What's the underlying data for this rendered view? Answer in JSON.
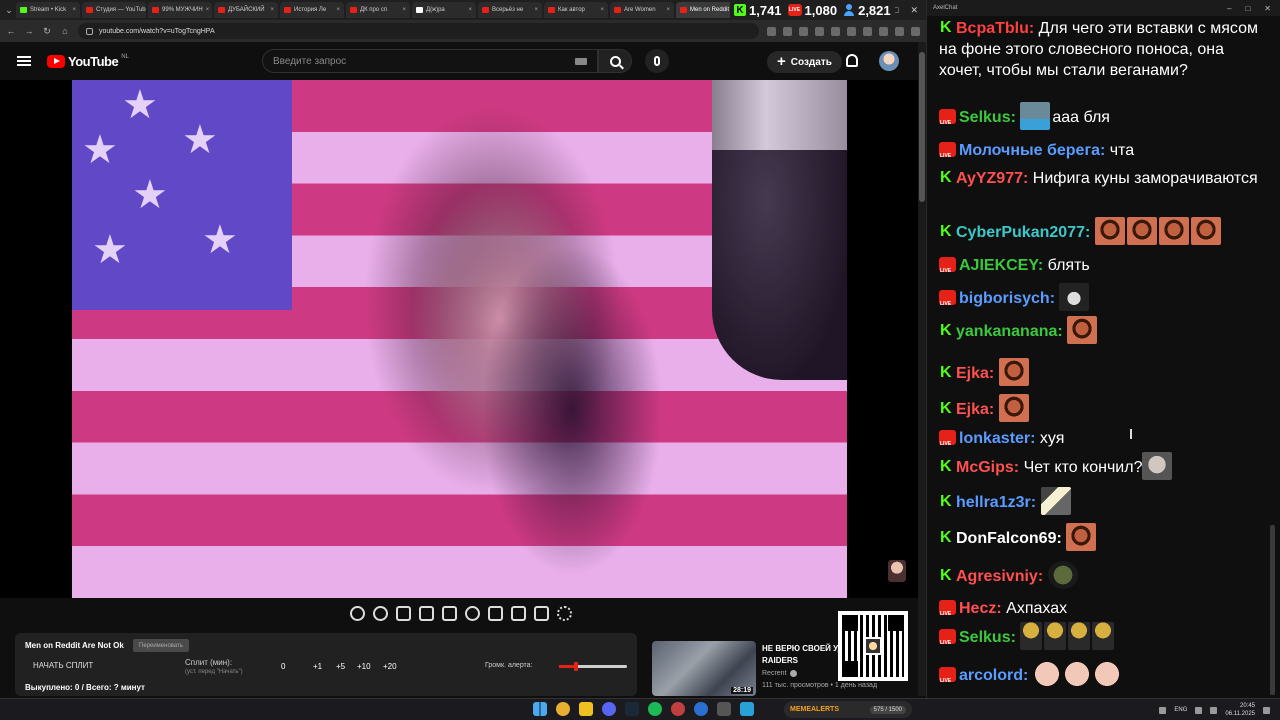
{
  "browser": {
    "tabs": [
      {
        "label": "Stream • Kick",
        "icon": "kick"
      },
      {
        "label": "Студия — YouTube",
        "icon": "youtube"
      },
      {
        "label": "99% МУЖЧИН",
        "icon": "youtube"
      },
      {
        "label": "ДУБАЙСКИЙ",
        "icon": "youtube"
      },
      {
        "label": "История Ле",
        "icon": "youtube"
      },
      {
        "label": "ДК про сп",
        "icon": "youtube"
      },
      {
        "label": "Д(ж)ра",
        "icon": "dark"
      },
      {
        "label": "Всерьёз не",
        "icon": "youtube"
      },
      {
        "label": "Как автор",
        "icon": "youtube"
      },
      {
        "label": "Are Women",
        "icon": "youtube"
      },
      {
        "label": "Men on Reddit",
        "icon": "youtube",
        "active": true
      }
    ],
    "url": "youtube.com/watch?v=uTogTcngHPA",
    "counters": {
      "kick": "1,741",
      "youtube": "1,080",
      "total": "2,821"
    }
  },
  "youtube": {
    "logo_text": "YouTube",
    "country": "NL",
    "search_placeholder": "Введите запрос",
    "create_label": "Создать"
  },
  "split_panel": {
    "title": "Men on Reddit Are Not Ok",
    "rename_label": "Переименовать",
    "start_button": "НАЧАТЬ СПЛИТ",
    "split_label": "Сплит (мин):",
    "split_hint": "(уст. перед \"Начать\")",
    "split_value": "0",
    "steps": [
      "+1",
      "+5",
      "+10",
      "+20"
    ],
    "alert_volume_label": "Громк. алерта:",
    "alert_volume": 0.25,
    "bought_text": "Выкуплено: 0 / Всего: ? минут"
  },
  "recommendation": {
    "title_line1": "НЕ ВЕРЮ СВОЕЙ УДАЧЕ",
    "title_line2": "RAIDERS",
    "channel": "Recrent",
    "meta": "111 тыс. просмотров • 1 день назад",
    "duration": "28:19"
  },
  "chat": {
    "window_title": "AxelChat",
    "messages": [
      {
        "platform": "kick",
        "user": "BcpaTblu",
        "color": "#ff4040",
        "text": "Для чего эти вставки с мясом на фоне этого словесного поноса, она хочет, чтобы мы стали веганами?",
        "emotes": []
      },
      {
        "platform": "youtube",
        "user": "Selkus",
        "color": "#3cc83c",
        "text": "ааа бля",
        "emotes": [
          "sky"
        ],
        "emote_first": true
      },
      {
        "platform": "youtube",
        "user": "Молочные берега",
        "color": "#5a9cff",
        "text": "чта",
        "emotes": []
      },
      {
        "platform": "kick",
        "user": "AyYZ977",
        "color": "#ff5050",
        "text": "Нифига куны заморачиваются",
        "emotes": []
      },
      {
        "platform": "kick",
        "user": "CyberPukan2077",
        "color": "#3cc8c8",
        "text": "",
        "emotes": [
          "face",
          "face",
          "face",
          "face"
        ]
      },
      {
        "platform": "youtube",
        "user": "AJIEKCEY",
        "color": "#3cc83c",
        "text": "блять",
        "emotes": []
      },
      {
        "platform": "youtube",
        "user": "bigborisych",
        "color": "#5a9cff",
        "text": "",
        "emotes": [
          "cat"
        ]
      },
      {
        "platform": "kick",
        "user": "yankananana",
        "color": "#3cc83c",
        "text": "",
        "emotes": [
          "face"
        ]
      },
      {
        "platform": "kick",
        "user": "Ejka",
        "color": "#ff5050",
        "text": "",
        "emotes": [
          "face"
        ]
      },
      {
        "platform": "kick",
        "user": "Ejka",
        "color": "#ff5050",
        "text": "",
        "emotes": [
          "face"
        ]
      },
      {
        "platform": "youtube",
        "user": "lonkaster",
        "color": "#5a9cff",
        "text": "хуя",
        "emotes": []
      },
      {
        "platform": "kick",
        "user": "McGips",
        "color": "#ff5050",
        "text": "Чет кто кончил?",
        "emotes": [
          "old"
        ]
      },
      {
        "platform": "kick",
        "user": "hellra1z3r",
        "color": "#5a9cff",
        "text": "",
        "emotes": [
          "kw"
        ]
      },
      {
        "platform": "kick",
        "user": "DonFalcon69",
        "color": "#ffffff",
        "text": "",
        "emotes": [
          "face"
        ]
      },
      {
        "platform": "kick",
        "user": "Agresivniy",
        "color": "#ff5050",
        "text": "",
        "emotes": [
          "pepe"
        ]
      },
      {
        "platform": "youtube",
        "user": "Hecz",
        "color": "#ff5050",
        "text": "Ахпахах",
        "emotes": []
      },
      {
        "platform": "youtube",
        "user": "Selkus",
        "color": "#3cc83c",
        "text": "",
        "emotes": [
          "golden",
          "golden",
          "golden",
          "golden"
        ]
      },
      {
        "platform": "youtube",
        "user": "arcolord",
        "color": "#5a9cff",
        "text": "",
        "emotes": [
          "bald",
          "bald",
          "bald"
        ]
      }
    ]
  },
  "taskbar": {
    "memealert_label": "MEMEALERTS",
    "memealert_count": "575 / 1500",
    "lang": "ENG",
    "time": "20:45",
    "date": "06.11.2025"
  }
}
